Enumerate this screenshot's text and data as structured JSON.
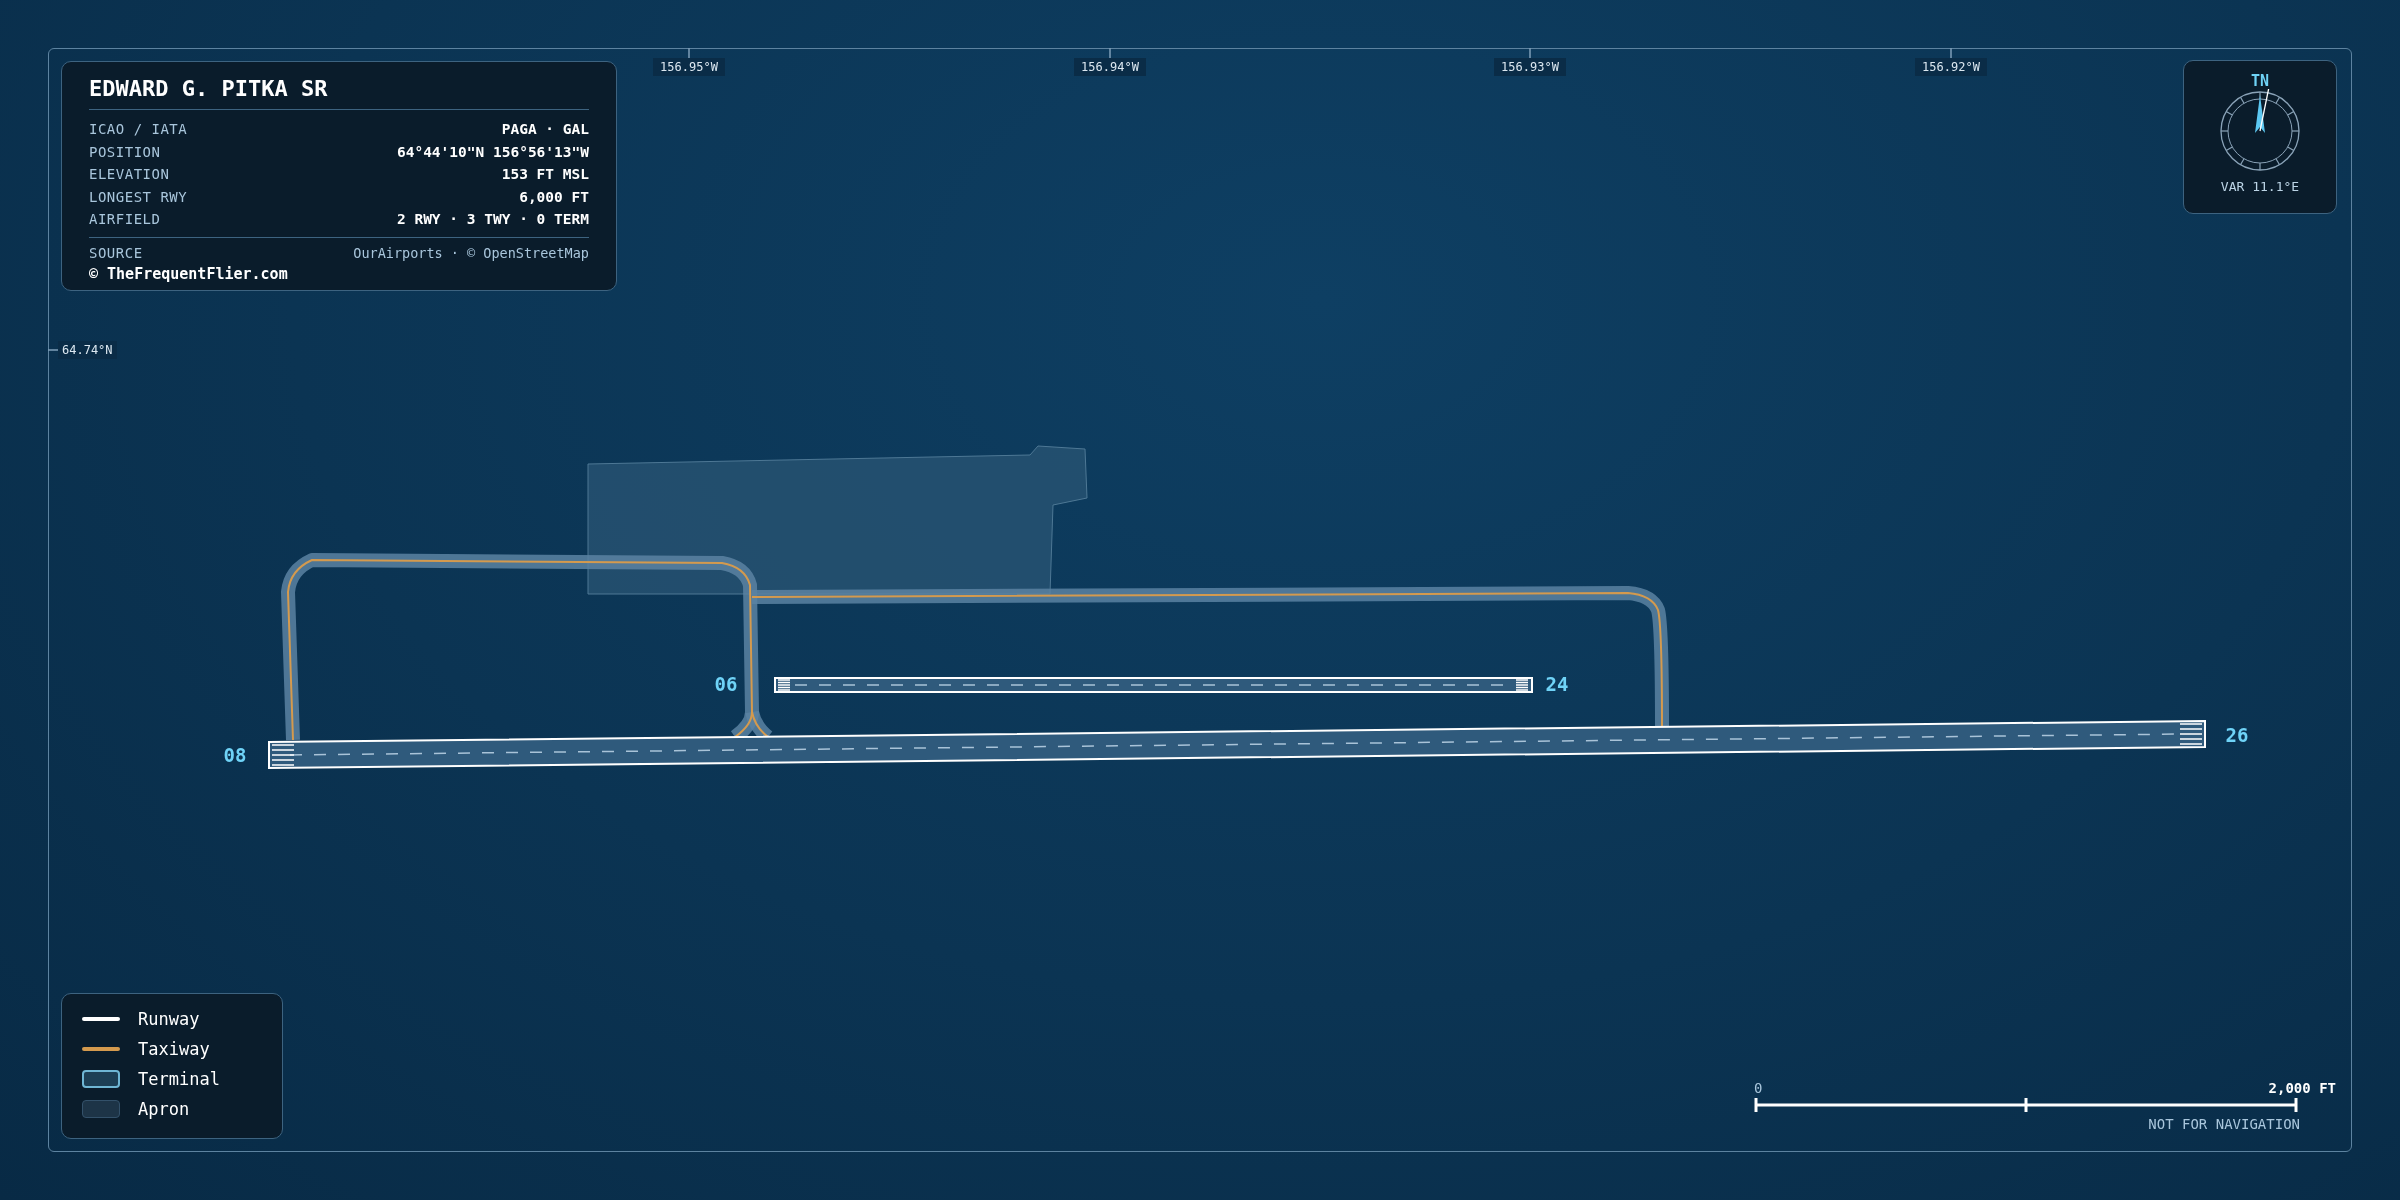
{
  "map": {
    "longitude_labels": [
      "156.95°W",
      "156.94°W",
      "156.93°W",
      "156.92°W"
    ],
    "latitude_labels": [
      "64.74°N"
    ],
    "runways": [
      {
        "ends": [
          "08",
          "26"
        ]
      },
      {
        "ends": [
          "06",
          "24"
        ]
      }
    ]
  },
  "info_panel": {
    "title": "EDWARD G. PITKA SR",
    "rows": [
      {
        "label": "ICAO / IATA",
        "value": "PAGA · GAL"
      },
      {
        "label": "POSITION",
        "value": "64°44'10\"N 156°56'13\"W"
      },
      {
        "label": "ELEVATION",
        "value": "153 FT MSL"
      },
      {
        "label": "LONGEST RWY",
        "value": "6,000 FT"
      },
      {
        "label": "AIRFIELD",
        "value": "2 RWY · 3 TWY · 0 TERM"
      }
    ],
    "source_label": "SOURCE",
    "source_value": "OurAirports · © OpenStreetMap",
    "copyright": "© TheFrequentFlier.com"
  },
  "compass": {
    "label": "TN",
    "variation": "VAR 11.1°E"
  },
  "legend": [
    {
      "kind": "runway",
      "label": "Runway"
    },
    {
      "kind": "taxiway",
      "label": "Taxiway"
    },
    {
      "kind": "terminal",
      "label": "Terminal"
    },
    {
      "kind": "apron",
      "label": "Apron"
    }
  ],
  "scale_bar": {
    "start": "0",
    "end": "2,000 FT",
    "note": "NOT FOR NAVIGATION"
  }
}
